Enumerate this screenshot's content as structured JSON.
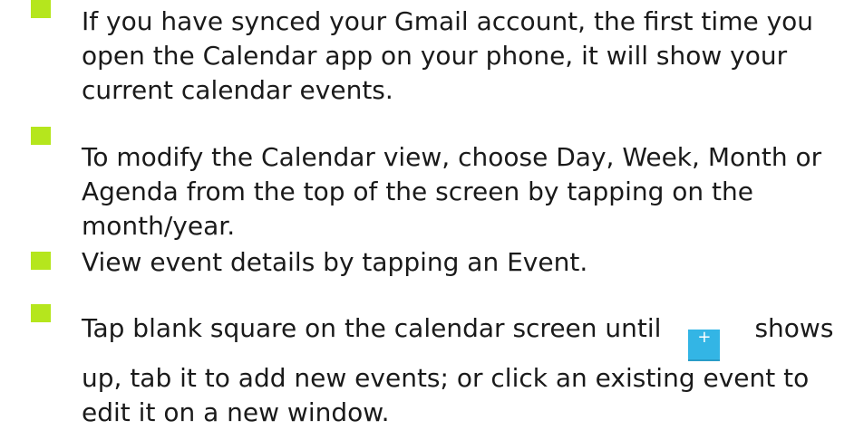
{
  "bullets": [
    {
      "lines": [
        "If you have synced your Gmail account, the first time you",
        "open the Calendar app on your phone, it will show your",
        "current calendar events."
      ]
    },
    {
      "lines": [
        "To modify the Calendar view, choose Day, Week, Month or",
        "Agenda from the top of the screen by tapping on the",
        "month/year."
      ]
    },
    {
      "lines": [
        "View event details by tapping an Event."
      ]
    },
    {
      "line1_before_icon": "Tap blank square on the calendar screen until",
      "line1_after_icon": "shows",
      "lines_rest": [
        "up, tab it to add new events; or click an existing event to",
        "edit it on a new window."
      ]
    }
  ],
  "icons": {
    "bullet_color": "#b5e61d",
    "add_event_icon": "plus-icon",
    "add_event_glyph": "+",
    "add_event_color": "#33b5e5"
  }
}
